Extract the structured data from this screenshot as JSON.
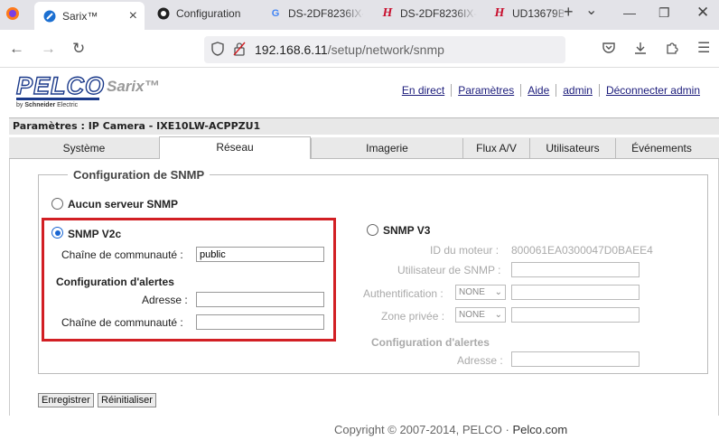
{
  "browser": {
    "tabs": [
      {
        "title": "Sarix™",
        "icon": "pelco-icon",
        "active": true
      },
      {
        "title": "Configuration",
        "icon": "camera-icon"
      },
      {
        "title": "DS-2DF8236IX-",
        "icon": "google-icon"
      },
      {
        "title": "DS-2DF8236IX-",
        "icon": "hikvision-icon"
      },
      {
        "title": "UD13679B-",
        "icon": "hikvision-icon"
      }
    ],
    "new_tab": "+",
    "tab_list": "⌄",
    "url_host": "192.168.6.11",
    "url_path": "/setup/network/snmp"
  },
  "header": {
    "logo": "PELCO",
    "product": "Sarix™",
    "sub_logo_by": "by",
    "sub_logo_brand": "Schneider",
    "sub_logo_tail": "Electric",
    "links": [
      "En direct",
      "Paramètres",
      "Aide",
      "admin",
      "Déconnecter admin"
    ]
  },
  "param_bar": "Paramètres : IP Camera - IXE10LW-ACPPZU1",
  "tabs": [
    "Système",
    "Réseau",
    "Imagerie",
    "Flux A/V",
    "Utilisateurs",
    "Événements"
  ],
  "active_tab": "Réseau",
  "snmp": {
    "legend": "Configuration de SNMP",
    "none_label": "Aucun serveur SNMP",
    "v2c": {
      "label": "SNMP V2c",
      "community_label": "Chaîne de communauté :",
      "community_value": "public",
      "alerts_heading": "Configuration d'alertes",
      "address_label": "Adresse :",
      "address_value": "",
      "alert_community_label": "Chaîne de communauté :",
      "alert_community_value": ""
    },
    "v3": {
      "label": "SNMP V3",
      "engine_label": "ID du moteur :",
      "engine_value": "800061EA0300047D0BAEE4",
      "user_label": "Utilisateur de SNMP :",
      "auth_label": "Authentification :",
      "auth_value": "NONE",
      "privacy_label": "Zone privée :",
      "privacy_value": "NONE",
      "alerts_heading": "Configuration d'alertes",
      "address_label": "Adresse :"
    }
  },
  "buttons": {
    "save": "Enregistrer",
    "reset": "Réinitialiser"
  },
  "footer": {
    "copyright": "Copyright © 2007-2014, PELCO · ",
    "link": "Pelco.com"
  },
  "colors": {
    "highlight": "#d21f24",
    "brand": "#1b3a8a",
    "radio": "#1a66d2"
  }
}
